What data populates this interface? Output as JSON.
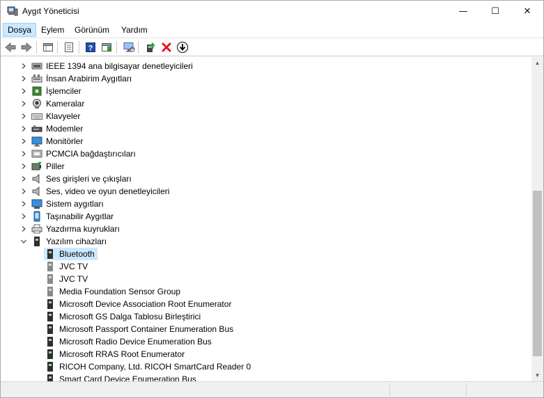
{
  "window": {
    "title": "Aygıt Yöneticisi",
    "minimize_glyph": "—",
    "maximize_glyph": "☐",
    "close_glyph": "✕"
  },
  "menu": [
    {
      "label": "Dosya",
      "active": true
    },
    {
      "label": "Eylem",
      "active": false
    },
    {
      "label": "Görünüm",
      "active": false
    },
    {
      "label": "Yardım",
      "active": false
    }
  ],
  "toolbar": {
    "icons": [
      "back-icon",
      "forward-icon",
      "properties-window-icon",
      "properties-sheet-icon",
      "help-icon",
      "action-pane-icon",
      "scan-hardware-icon",
      "update-driver-icon",
      "uninstall-device-icon",
      "download-icon"
    ],
    "colors": {
      "red_x": "#e81123",
      "help_blue": "#1f4ea8",
      "green": "#2e9e3c"
    }
  },
  "tree": {
    "categories": [
      {
        "label": "IEEE 1394 ana bilgisayar denetleyicileri",
        "icon": "ieee1394-icon"
      },
      {
        "label": "İnsan Arabirim Aygıtları",
        "icon": "hid-icon"
      },
      {
        "label": "İşlemciler",
        "icon": "processor-icon"
      },
      {
        "label": "Kameralar",
        "icon": "camera-icon"
      },
      {
        "label": "Klavyeler",
        "icon": "keyboard-icon"
      },
      {
        "label": "Modemler",
        "icon": "modem-icon"
      },
      {
        "label": "Monitörler",
        "icon": "monitor-icon"
      },
      {
        "label": "PCMCIA bağdaştırıcıları",
        "icon": "pcmcia-icon"
      },
      {
        "label": "Piller",
        "icon": "battery-icon"
      },
      {
        "label": "Ses girişleri ve çıkışları",
        "icon": "speaker-icon"
      },
      {
        "label": "Ses, video ve oyun denetleyicileri",
        "icon": "audio-controller-icon"
      },
      {
        "label": "Sistem aygıtları",
        "icon": "system-device-icon"
      },
      {
        "label": "Taşınabilir Aygıtlar",
        "icon": "portable-device-icon"
      },
      {
        "label": "Yazdırma kuyrukları",
        "icon": "printer-icon"
      },
      {
        "label": "Yazılım cihazları",
        "icon": "software-device-icon",
        "expanded": true
      }
    ],
    "children": [
      {
        "label": "Bluetooth",
        "selected": true,
        "dim": false
      },
      {
        "label": "JVC TV",
        "selected": false,
        "dim": true
      },
      {
        "label": "JVC TV",
        "selected": false,
        "dim": true
      },
      {
        "label": "Media Foundation Sensor Group",
        "selected": false,
        "dim": true
      },
      {
        "label": "Microsoft Device Association Root Enumerator",
        "selected": false,
        "dim": false
      },
      {
        "label": "Microsoft GS Dalga Tablosu Birleştirici",
        "selected": false,
        "dim": false
      },
      {
        "label": "Microsoft Passport Container Enumeration Bus",
        "selected": false,
        "dim": false
      },
      {
        "label": "Microsoft Radio Device Enumeration Bus",
        "selected": false,
        "dim": false
      },
      {
        "label": "Microsoft RRAS Root Enumerator",
        "selected": false,
        "dim": false
      },
      {
        "label": "RICOH Company, Ltd. RICOH SmartCard Reader 0",
        "selected": false,
        "dim": false
      },
      {
        "label": "Smart Card Device Enumeration Bus",
        "selected": false,
        "dim": false
      }
    ]
  }
}
